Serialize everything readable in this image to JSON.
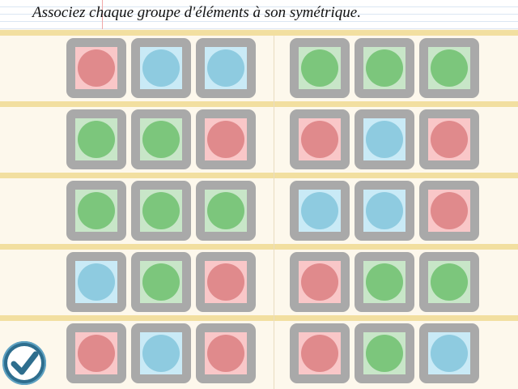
{
  "instruction": "Associez chaque groupe d'éléments à son symétrique.",
  "colors": {
    "red": "#e08a8c",
    "blue": "#8ecbe0",
    "green": "#7cc67c",
    "tile_frame": "#a9a9a9",
    "check_button": "#2e6e8e"
  },
  "rows": [
    {
      "left": [
        "red",
        "blue",
        "blue"
      ],
      "right": [
        "green",
        "green",
        "green"
      ]
    },
    {
      "left": [
        "green",
        "green",
        "red"
      ],
      "right": [
        "red",
        "blue",
        "red"
      ]
    },
    {
      "left": [
        "green",
        "green",
        "green"
      ],
      "right": [
        "blue",
        "blue",
        "red"
      ]
    },
    {
      "left": [
        "blue",
        "green",
        "red"
      ],
      "right": [
        "red",
        "green",
        "green"
      ]
    },
    {
      "left": [
        "red",
        "blue",
        "red"
      ],
      "right": [
        "red",
        "green",
        "blue"
      ]
    }
  ],
  "check_button_icon": "checkmark-icon"
}
